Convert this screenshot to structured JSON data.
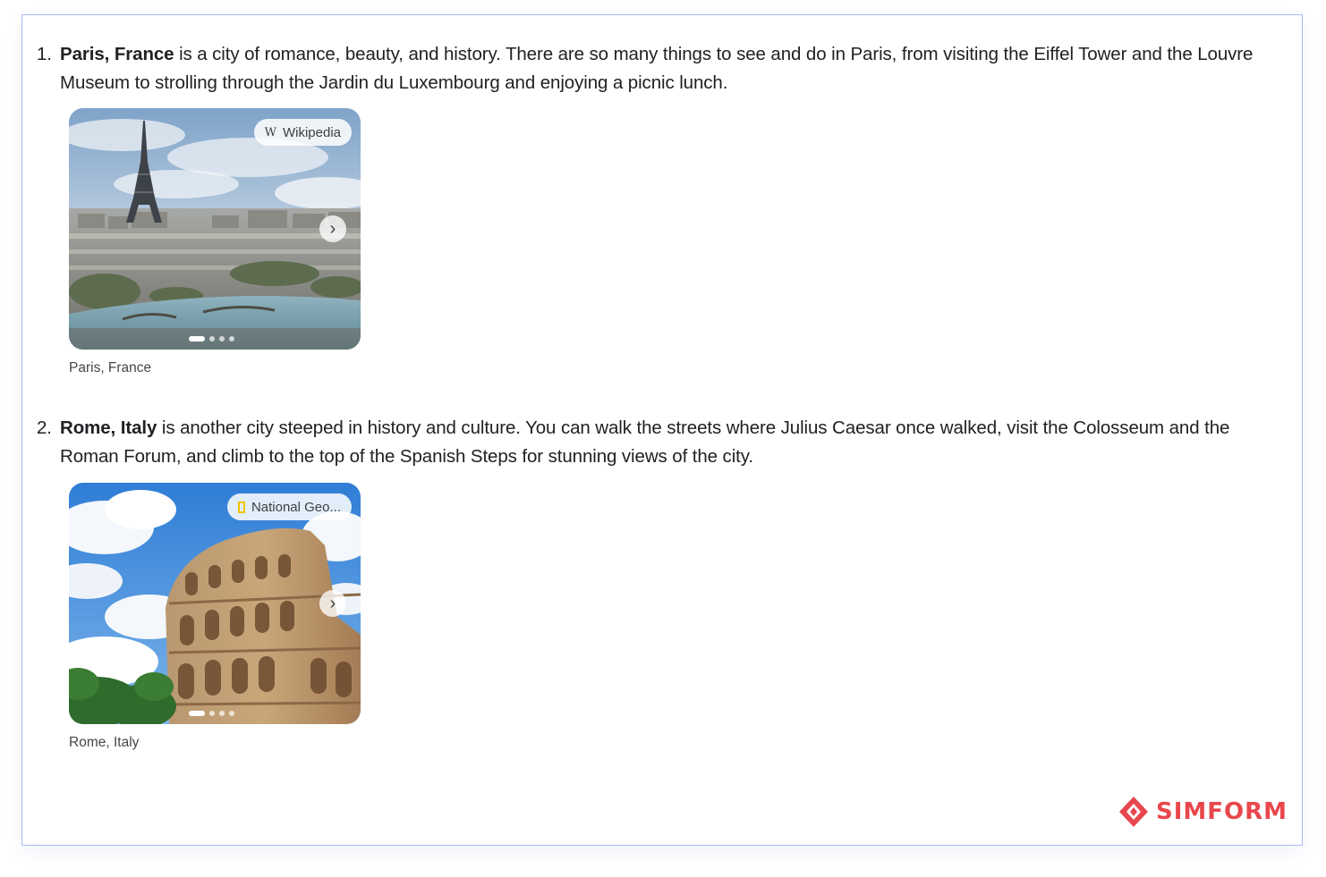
{
  "items": [
    {
      "number": "1.",
      "title": "Paris, France",
      "text": " is a city of romance, beauty, and history. There are so many things to see and do in Paris, from visiting the Eiffel Tower and the Louvre Museum to strolling through the Jardin du Luxembourg and enjoying a picnic lunch.",
      "source": "Wikipedia",
      "source_icon": "W",
      "caption": "Paris, France",
      "next_icon": "›"
    },
    {
      "number": "2.",
      "title": "Rome, Italy",
      "text": " is another city steeped in history and culture. You can walk the streets where Julius Caesar once walked, visit the Colosseum and the Roman Forum, and climb to the top of the Spanish Steps for stunning views of the city.",
      "source": "National Geo...",
      "caption": "Rome, Italy",
      "next_icon": "›"
    }
  ],
  "brand": {
    "name": "SIMFORM",
    "color": "#e8474d"
  }
}
